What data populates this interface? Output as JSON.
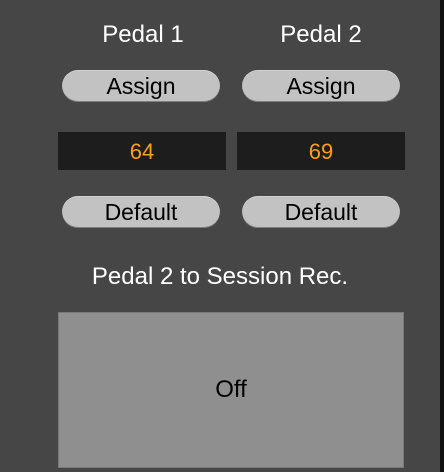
{
  "pedals": [
    {
      "title": "Pedal 1",
      "assign_label": "Assign",
      "value": "64",
      "default_label": "Default"
    },
    {
      "title": "Pedal 2",
      "assign_label": "Assign",
      "value": "69",
      "default_label": "Default"
    }
  ],
  "session_rec": {
    "label": "Pedal 2 to Session Rec.",
    "toggle_value": "Off"
  },
  "colors": {
    "panel_bg": "#464646",
    "button_bg": "#c2c2c2",
    "value_bg": "#1d1d1d",
    "value_text": "#ff9c1e",
    "toggle_bg": "#8f8f8f"
  }
}
